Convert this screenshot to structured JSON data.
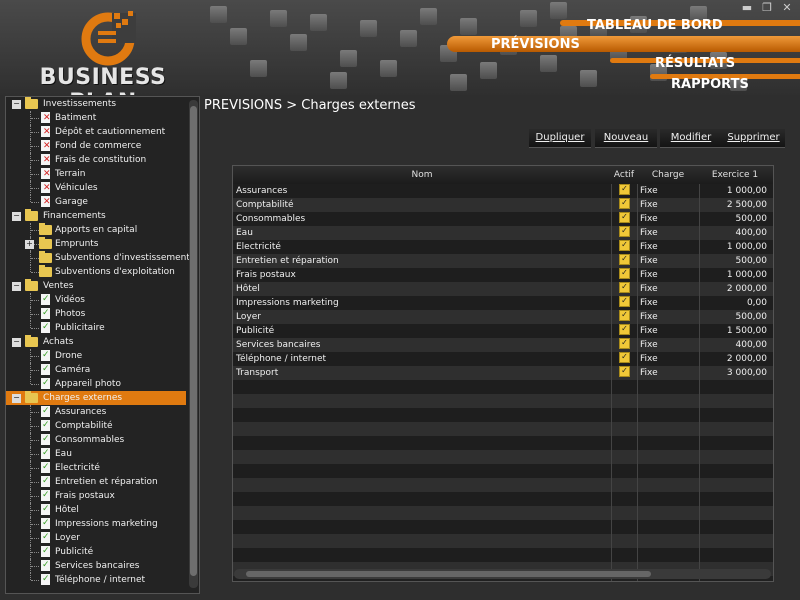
{
  "header": {
    "brand": "BUSINESS PLAN",
    "nav": {
      "tableau": "TABLEAU DE BORD",
      "previsions": "PRÉVISIONS",
      "resultats": "RÉSULTATS",
      "rapports": "RAPPORTS"
    },
    "window_controls": [
      "minimize-icon",
      "restore-icon",
      "close-icon"
    ]
  },
  "sidebar": {
    "groups": [
      {
        "label": "Investissements",
        "items": [
          "Batiment",
          "Dépôt et cautionnement",
          "Fond de commerce",
          "Frais de constitution",
          "Terrain",
          "Véhicules",
          "Garage"
        ]
      },
      {
        "label": "Financements",
        "items": [
          "Apports en capital",
          "Emprunts",
          "Subventions d'investissement",
          "Subventions d'exploitation"
        ]
      },
      {
        "label": "Ventes",
        "items": [
          "Vidéos",
          "Photos",
          "Publicitaire"
        ]
      },
      {
        "label": "Achats",
        "items": [
          "Drone",
          "Caméra",
          "Appareil photo"
        ]
      },
      {
        "label": "Charges externes",
        "items": [
          "Assurances",
          "Comptabilité",
          "Consommables",
          "Eau",
          "Electricité",
          "Entretien et réparation",
          "Frais postaux",
          "Hôtel",
          "Impressions marketing",
          "Loyer",
          "Publicité",
          "Services bancaires",
          "Téléphone / internet"
        ]
      }
    ],
    "selected_group": "Charges externes"
  },
  "breadcrumb": "PREVISIONS > Charges externes",
  "toolbar": {
    "dupliquer": "Dupliquer",
    "nouveau": "Nouveau",
    "modifier": "Modifier",
    "supprimer": "Supprimer"
  },
  "grid": {
    "columns": {
      "nom": "Nom",
      "actif": "Actif",
      "charge": "Charge",
      "exercice": "Exercice 1"
    },
    "rows": [
      {
        "nom": "Assurances",
        "actif": true,
        "charge": "Fixe",
        "exercice": "1 000,00"
      },
      {
        "nom": "Comptabilité",
        "actif": true,
        "charge": "Fixe",
        "exercice": "2 500,00"
      },
      {
        "nom": "Consommables",
        "actif": true,
        "charge": "Fixe",
        "exercice": "500,00"
      },
      {
        "nom": "Eau",
        "actif": true,
        "charge": "Fixe",
        "exercice": "400,00"
      },
      {
        "nom": "Electricité",
        "actif": true,
        "charge": "Fixe",
        "exercice": "1 000,00"
      },
      {
        "nom": "Entretien et réparation",
        "actif": true,
        "charge": "Fixe",
        "exercice": "500,00"
      },
      {
        "nom": "Frais postaux",
        "actif": true,
        "charge": "Fixe",
        "exercice": "1 000,00"
      },
      {
        "nom": "Hôtel",
        "actif": true,
        "charge": "Fixe",
        "exercice": "2 000,00"
      },
      {
        "nom": "Impressions marketing",
        "actif": true,
        "charge": "Fixe",
        "exercice": "0,00"
      },
      {
        "nom": "Loyer",
        "actif": true,
        "charge": "Fixe",
        "exercice": "500,00"
      },
      {
        "nom": "Publicité",
        "actif": true,
        "charge": "Fixe",
        "exercice": "1 500,00"
      },
      {
        "nom": "Services bancaires",
        "actif": true,
        "charge": "Fixe",
        "exercice": "400,00"
      },
      {
        "nom": "Téléphone / internet",
        "actif": true,
        "charge": "Fixe",
        "exercice": "2 000,00"
      },
      {
        "nom": "Transport",
        "actif": true,
        "charge": "Fixe",
        "exercice": "3 000,00"
      }
    ]
  },
  "colors": {
    "accent": "#e07a10",
    "background": "#2e2e2e",
    "folder": "#e8c651",
    "checkbox": "#f0c838"
  }
}
